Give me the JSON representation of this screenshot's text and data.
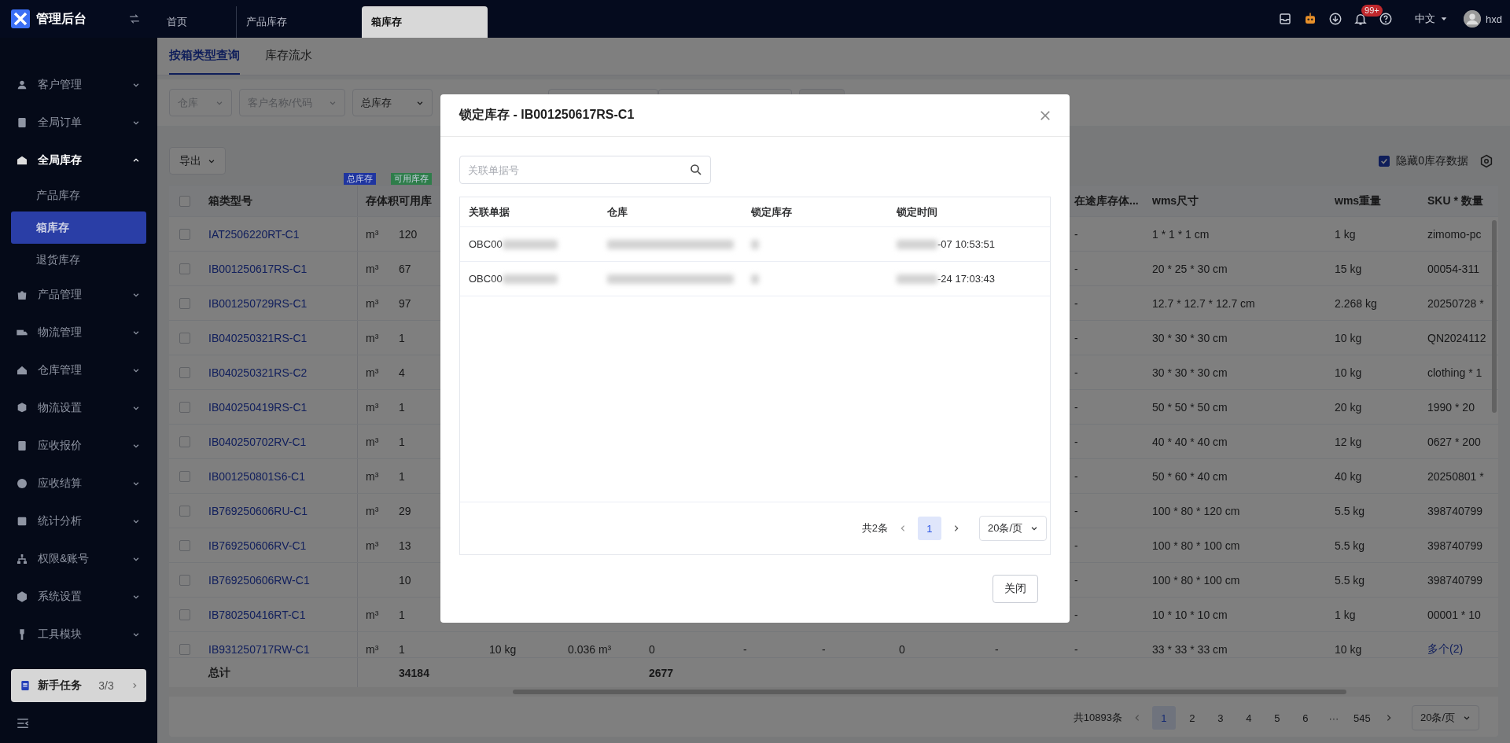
{
  "app": {
    "title": "管理后台"
  },
  "header_tabs": [
    {
      "label": "首页",
      "selected": false
    },
    {
      "label": "产品库存",
      "selected": false
    },
    {
      "label": "箱库存",
      "selected": true
    }
  ],
  "header": {
    "notification_badge": "99+",
    "language": "中文",
    "user": "hxd"
  },
  "sidebar": {
    "items": [
      {
        "label": "客户管理",
        "expanded": false
      },
      {
        "label": "全局订单",
        "expanded": false
      },
      {
        "label": "全局库存",
        "expanded": true,
        "children": [
          {
            "label": "产品库存",
            "selected": false
          },
          {
            "label": "箱库存",
            "selected": true
          },
          {
            "label": "退货库存",
            "selected": false
          }
        ]
      },
      {
        "label": "产品管理",
        "expanded": false
      },
      {
        "label": "物流管理",
        "expanded": false
      },
      {
        "label": "仓库管理",
        "expanded": false
      },
      {
        "label": "物流设置",
        "expanded": false
      },
      {
        "label": "应收报价",
        "expanded": false
      },
      {
        "label": "应收结算",
        "expanded": false
      },
      {
        "label": "统计分析",
        "expanded": false
      },
      {
        "label": "权限&账号",
        "expanded": false
      },
      {
        "label": "系统设置",
        "expanded": false
      },
      {
        "label": "工具模块",
        "expanded": false
      }
    ],
    "task_card": {
      "label": "新手任务",
      "progress": "3/3"
    }
  },
  "subtabs": [
    {
      "label": "按箱类型查询",
      "selected": true
    },
    {
      "label": "库存流水",
      "selected": false
    }
  ],
  "filters": [
    {
      "placeholder": "仓库"
    },
    {
      "placeholder": "客户名称/代码"
    },
    {
      "value": "总库存"
    }
  ],
  "toolbar": {
    "export": "导出",
    "hide_zero": {
      "label": "隐藏0库存数据",
      "checked": true
    }
  },
  "table": {
    "header_checked": false,
    "column_groups": [
      {
        "label": "总库存",
        "color": "#1f35a0"
      },
      {
        "label": "可用库存",
        "color": "#2e7d4a"
      }
    ],
    "columns": [
      "箱类型号",
      "存体积",
      "可用库",
      null,
      null,
      null,
      null,
      null,
      null,
      null,
      "在途库存体...",
      "wms尺寸",
      "wms重量",
      "SKU * 数量"
    ],
    "rows": [
      {
        "checked": false,
        "sku_link": false,
        "cells": [
          "IAT2506220RT-C1",
          "m³",
          "120",
          null,
          null,
          null,
          null,
          null,
          null,
          null,
          "-",
          "1 * 1 * 1 cm",
          "1 kg",
          "zimomo-pc"
        ]
      },
      {
        "checked": false,
        "sku_link": false,
        "cells": [
          "IB001250617RS-C1",
          "m³",
          "67",
          null,
          null,
          null,
          null,
          null,
          null,
          null,
          "-",
          "20 * 25 * 30 cm",
          "15 kg",
          "00054-311"
        ]
      },
      {
        "checked": false,
        "sku_link": false,
        "cells": [
          "IB001250729RS-C1",
          "m³",
          "97",
          null,
          null,
          null,
          null,
          null,
          null,
          null,
          "-",
          "12.7 * 12.7 * 12.7 cm",
          "2.268 kg",
          "20250728 *"
        ]
      },
      {
        "checked": false,
        "sku_link": false,
        "cells": [
          "IB040250321RS-C1",
          "m³",
          "1",
          null,
          null,
          null,
          null,
          null,
          null,
          null,
          "-",
          "30 * 30 * 30 cm",
          "10 kg",
          "QN2024112"
        ]
      },
      {
        "checked": false,
        "sku_link": false,
        "cells": [
          "IB040250321RS-C2",
          "m³",
          "4",
          null,
          null,
          null,
          null,
          null,
          null,
          null,
          "-",
          "30 * 30 * 30 cm",
          "10 kg",
          "clothing * 1"
        ]
      },
      {
        "checked": false,
        "sku_link": false,
        "cells": [
          "IB040250419RS-C1",
          "m³",
          "1",
          null,
          null,
          null,
          null,
          null,
          null,
          null,
          "-",
          "50 * 50 * 50 cm",
          "20 kg",
          "1990 * 20"
        ]
      },
      {
        "checked": false,
        "sku_link": false,
        "cells": [
          "IB040250702RV-C1",
          "m³",
          "1",
          null,
          null,
          null,
          null,
          null,
          null,
          null,
          "-",
          "40 * 40 * 40 cm",
          "12 kg",
          "0627 * 200"
        ]
      },
      {
        "checked": false,
        "sku_link": false,
        "cells": [
          "IB001250801S6-C1",
          "m³",
          "1",
          null,
          null,
          null,
          null,
          null,
          null,
          null,
          "-",
          "50 * 60 * 40 cm",
          "40 kg",
          "20250801 *"
        ]
      },
      {
        "checked": false,
        "sku_link": false,
        "cells": [
          "IB769250606RU-C1",
          "m³",
          "29",
          null,
          null,
          null,
          null,
          null,
          null,
          null,
          "-",
          "100 * 80 * 120 cm",
          "5.5 kg",
          "398740799"
        ]
      },
      {
        "checked": false,
        "sku_link": false,
        "cells": [
          "IB769250606RV-C1",
          "m³",
          "13",
          null,
          null,
          null,
          null,
          null,
          null,
          null,
          "-",
          "100 * 80 * 100 cm",
          "5.5 kg",
          "398740799"
        ]
      },
      {
        "checked": false,
        "sku_link": false,
        "cells": [
          "IB769250606RW-C1",
          null,
          "10",
          null,
          null,
          null,
          null,
          null,
          null,
          null,
          "-",
          "100 * 80 * 100 cm",
          "5.5 kg",
          "398740799"
        ]
      },
      {
        "checked": false,
        "sku_link": false,
        "cells": [
          "IB780250416RT-C1",
          "m³",
          "1",
          null,
          null,
          null,
          null,
          null,
          null,
          null,
          "-",
          "10 * 10 * 10 cm",
          "1 kg",
          "00001 * 10"
        ]
      },
      {
        "checked": false,
        "sku_link": true,
        "cells": [
          "IB931250717RW-C1",
          "m³",
          "1",
          "10 kg",
          "0.036 m³",
          "0",
          "-",
          "-",
          "0",
          "-",
          "-",
          "33 * 33 * 33 cm",
          "10 kg",
          "多个(2)"
        ]
      }
    ],
    "totals": {
      "label": "总计",
      "available": "34184",
      "column_6": "2677"
    }
  },
  "pagination": {
    "total": "共10893条",
    "pages": [
      {
        "label": "1",
        "selected": true
      },
      {
        "label": "2",
        "selected": false
      },
      {
        "label": "3",
        "selected": false
      },
      {
        "label": "4",
        "selected": false
      },
      {
        "label": "5",
        "selected": false
      },
      {
        "label": "6",
        "selected": false
      },
      {
        "label": "···",
        "selected": false
      },
      {
        "label": "545",
        "selected": false
      }
    ],
    "page_size": "20条/页"
  },
  "modal": {
    "title": "锁定库存 - IB001250617RS-C1",
    "search_placeholder": "关联单据号",
    "columns": [
      "关联单据",
      "仓库",
      "锁定库存",
      "锁定时间"
    ],
    "rows": [
      [
        "OBC00",
        "-07 10:53:51"
      ],
      [
        "OBC00",
        "-24 17:03:43"
      ]
    ],
    "pagination": {
      "total": "共2条",
      "pages": [
        {
          "label": "1",
          "selected": true
        }
      ],
      "page_size": "20条/页"
    },
    "close_button": "关闭"
  }
}
